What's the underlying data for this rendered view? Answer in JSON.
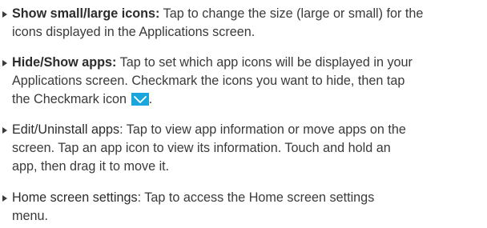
{
  "items": [
    {
      "term": "Show small/large icons:",
      "lines": [
        " Tap to change the size (large or small) for the",
        "icons displayed in the Applications screen."
      ]
    },
    {
      "term": "Hide/Show apps:",
      "lines": [
        " Tap to set which app icons will be displayed in your",
        "Applications screen. Checkmark the icons you want to hide, then tap",
        "the Checkmark icon",
        "."
      ],
      "icon": "checkmark-icon"
    },
    {
      "term": "Edit/Uninstall apps",
      "lines": [
        ": Tap to view app information or move apps on the",
        "screen. Tap an app icon to view its information. Touch and hold an",
        "app, then drag it to move it."
      ]
    },
    {
      "term": "Home screen settings",
      "lines": [
        ": Tap to access the Home screen settings",
        "menu."
      ]
    }
  ],
  "colors": {
    "text": "#3a3a3a",
    "checkmark_icon_bg": "#1aa6dc"
  }
}
